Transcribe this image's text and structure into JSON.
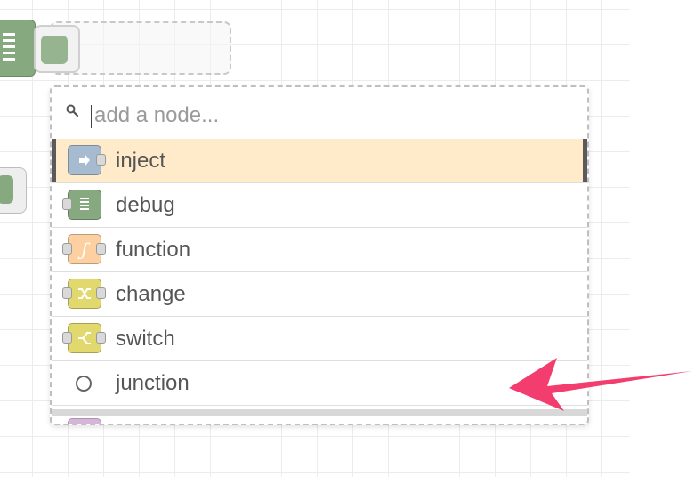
{
  "palette_search": {
    "placeholder": "add a node..."
  },
  "nodes": [
    {
      "label": "inject",
      "icon": "inject-arrow-icon",
      "color": "#a6bbcf",
      "ports": "out",
      "selected": true
    },
    {
      "label": "debug",
      "icon": "debug-list-icon",
      "color": "#87a980",
      "ports": "in",
      "selected": false
    },
    {
      "label": "function",
      "icon": "function-f-icon",
      "color": "#fdd0a2",
      "ports": "both",
      "selected": false
    },
    {
      "label": "change",
      "icon": "change-shuffle-icon",
      "color": "#e2d96e",
      "ports": "both",
      "selected": false
    },
    {
      "label": "switch",
      "icon": "switch-split-icon",
      "color": "#e2d96e",
      "ports": "both",
      "selected": false
    },
    {
      "label": "junction",
      "icon": "junction-circle-icon",
      "color": "#ffffff",
      "ports": "none",
      "selected": false
    }
  ],
  "colors": {
    "selected_row": "#ffebc9",
    "annotation_arrow": "#f23d6e",
    "grid": "#ececec"
  }
}
